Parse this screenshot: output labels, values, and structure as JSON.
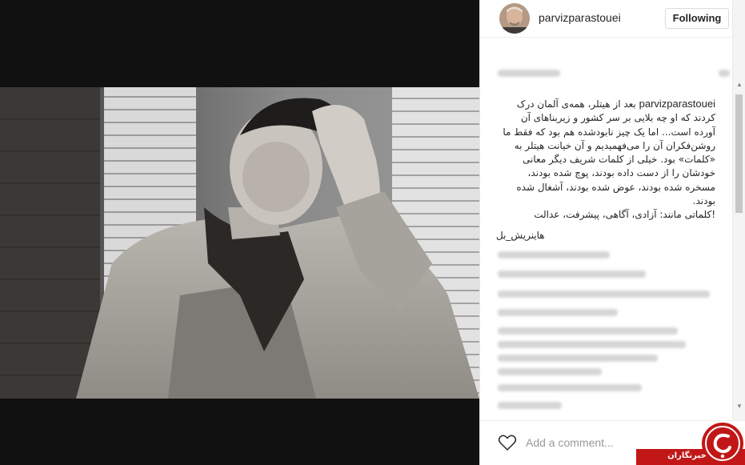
{
  "post": {
    "username": "parvizparastouei",
    "follow_button": "Following",
    "caption_username": "parvizparastouei",
    "caption_lines": [
      "بعد از هیتلر، همه‌ی آلمان درک",
      "کردند که او چه بلایی بر سر کشور و زیربناهای آن",
      "آورده است... اما یک چیز نابودشده هم بود که فقط ما",
      "روشن‌فکران آن را می‌فهمیدیم و آن خیانت هیتلر به",
      "«کلمات» بود. خیلی از کلمات شریف دیگر معانی",
      "خودشان را از دست داده بودند، پوچ شده بودند،",
      "مسخره شده بودند، عوض شده بودند، آشغال شده بودند.",
      "!کلماتی مانند: آزادی، آگاهی، پیشرفت، عدالت"
    ],
    "hashtag": "هاینریش_بل",
    "comment_placeholder": "Add a comment..."
  },
  "icons": {
    "heart": "heart-icon",
    "scroll_up": "scroll-up-arrow-icon",
    "scroll_down": "scroll-down-arrow-icon"
  },
  "watermark": {
    "text": "باشگاه خبرنگاران",
    "color": "#c21717"
  }
}
